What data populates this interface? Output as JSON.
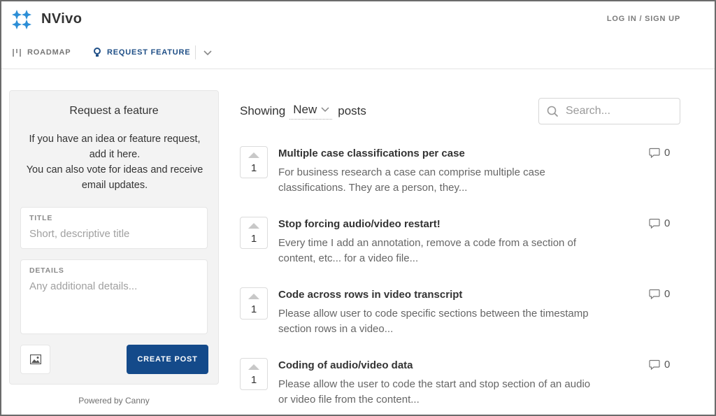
{
  "header": {
    "brand": "NVivo",
    "login_label": "LOG IN / SIGN UP",
    "nav": {
      "roadmap_label": "ROADMAP",
      "request_label": "REQUEST FEATURE"
    },
    "logo_color": "#2c8ed6",
    "active_nav_color": "#1e4e86"
  },
  "sidebar": {
    "title": "Request a feature",
    "description_line1": "If you have an idea or feature request, add it here.",
    "description_line2": "You can also vote for ideas and receive email updates.",
    "title_field": {
      "label": "TITLE",
      "placeholder": "Short, descriptive title",
      "value": ""
    },
    "details_field": {
      "label": "DETAILS",
      "placeholder": "Any additional details...",
      "value": ""
    },
    "create_label": "CREATE POST",
    "create_color": "#144a8a"
  },
  "powered_by": "Powered by Canny",
  "main": {
    "showing_prefix": "Showing",
    "sort_value": "New",
    "showing_suffix": "posts",
    "search_placeholder": "Search..."
  },
  "posts": [
    {
      "votes": "1",
      "title": "Multiple case classifications per case",
      "desc1": "For business research a case can comprise multiple case",
      "desc2": "classifications. They are a person, they...",
      "comments": "0"
    },
    {
      "votes": "1",
      "title": "Stop forcing audio/video restart!",
      "desc1": "Every time I add an annotation, remove a code from a section of",
      "desc2": "content, etc... for a video file...",
      "comments": "0"
    },
    {
      "votes": "1",
      "title": "Code across rows in video transcript",
      "desc1": "Please allow user to code specific sections between the timestamp",
      "desc2": "section rows in a video...",
      "comments": "0"
    },
    {
      "votes": "1",
      "title": "Coding of audio/video data",
      "desc1": "Please allow the user to code the start and stop section of an audio",
      "desc2": "or video file from the content...",
      "comments": "0"
    }
  ]
}
